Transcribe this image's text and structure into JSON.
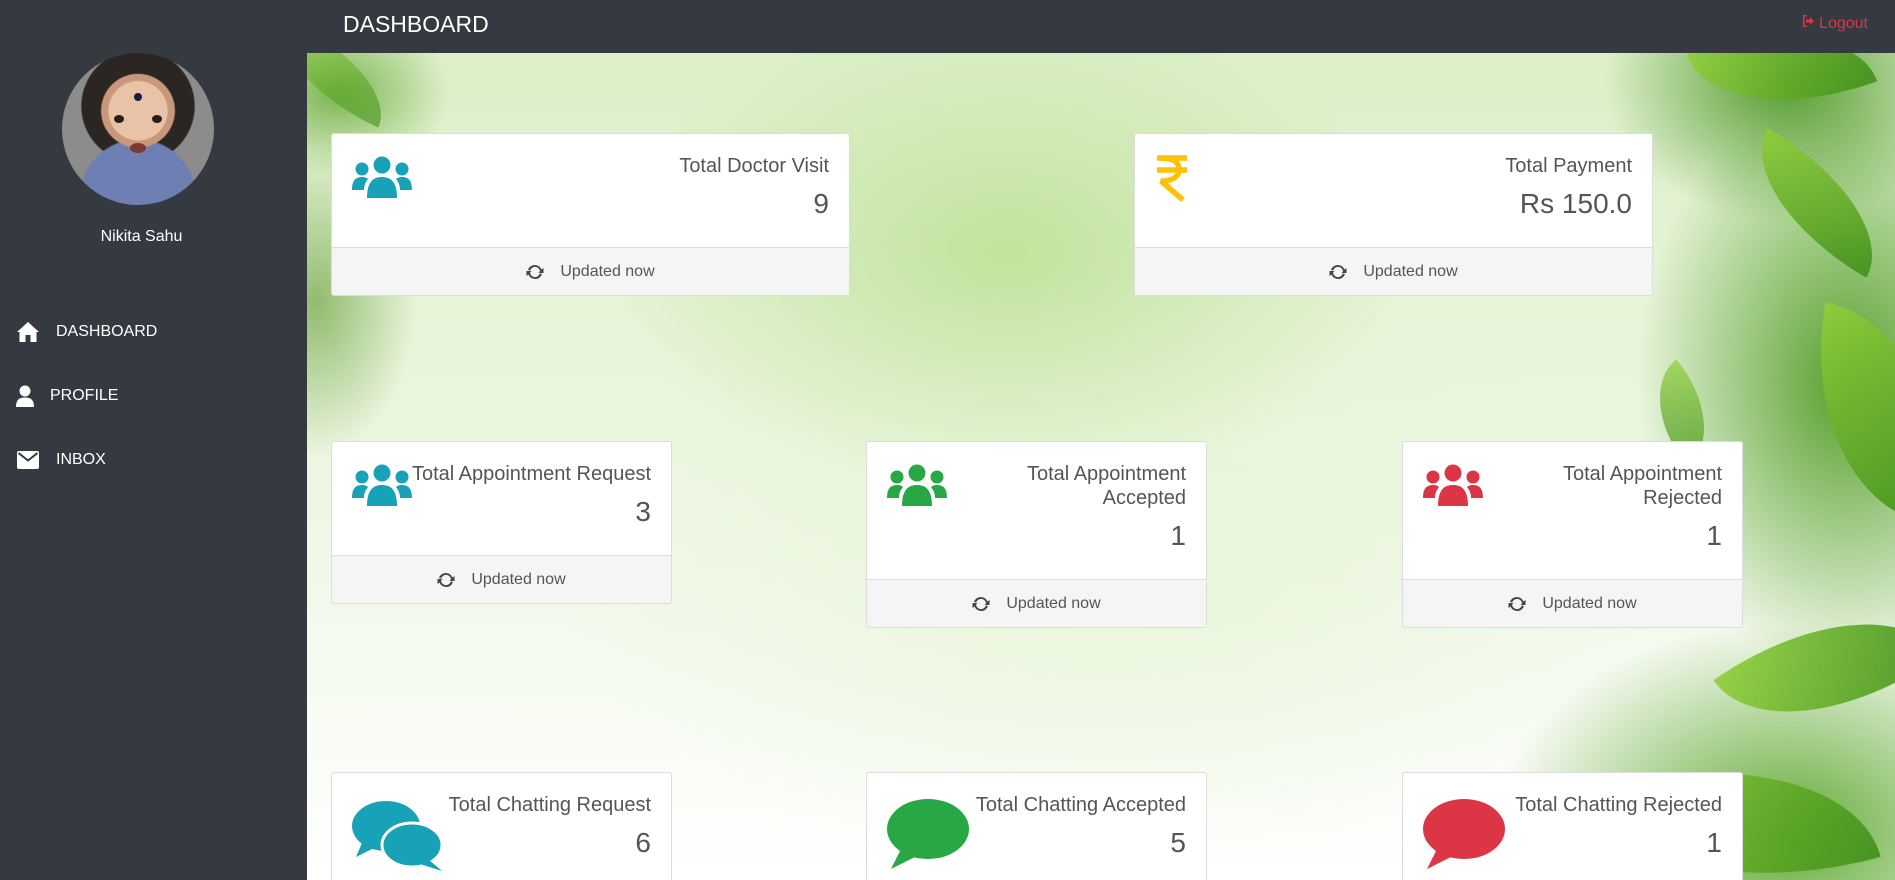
{
  "sidebar": {
    "user_name": "Nikita Sahu",
    "items": [
      {
        "label": "DASHBOARD",
        "icon": "home-icon"
      },
      {
        "label": "PROFILE",
        "icon": "user-icon"
      },
      {
        "label": "INBOX",
        "icon": "envelope-icon"
      }
    ]
  },
  "header": {
    "title": "DASHBOARD",
    "logout_label": "Logout"
  },
  "cards": {
    "doctor_visit": {
      "title": "Total Doctor Visit",
      "value": "9",
      "footer": "Updated now",
      "icon": "users-icon",
      "color": "#17a2b8"
    },
    "payment": {
      "title": "Total Payment",
      "value": "Rs 150.0",
      "footer": "Updated now",
      "icon": "rupee-icon",
      "color": "#ffc107"
    },
    "appointment_request": {
      "title": "Total Appointment Request",
      "value": "3",
      "footer": "Updated now",
      "icon": "users-icon",
      "color": "#17a2b8"
    },
    "appointment_accepted": {
      "title_line1": "Total Appointment",
      "title_line2": "Accepted",
      "value": "1",
      "footer": "Updated now",
      "icon": "users-icon",
      "color": "#28a745"
    },
    "appointment_rejected": {
      "title_line1": "Total Appointment",
      "title_line2": "Rejected",
      "value": "1",
      "footer": "Updated now",
      "icon": "users-icon",
      "color": "#dc3545"
    },
    "chatting_request": {
      "title": "Total Chatting Request",
      "value": "6",
      "icon": "comments-icon",
      "color": "#17a2b8"
    },
    "chatting_accepted": {
      "title": "Total Chatting Accepted",
      "value": "5",
      "icon": "comment-icon",
      "color": "#28a745"
    },
    "chatting_rejected": {
      "title": "Total Chatting Rejected",
      "value": "1",
      "icon": "comment-icon",
      "color": "#dc3545"
    }
  }
}
